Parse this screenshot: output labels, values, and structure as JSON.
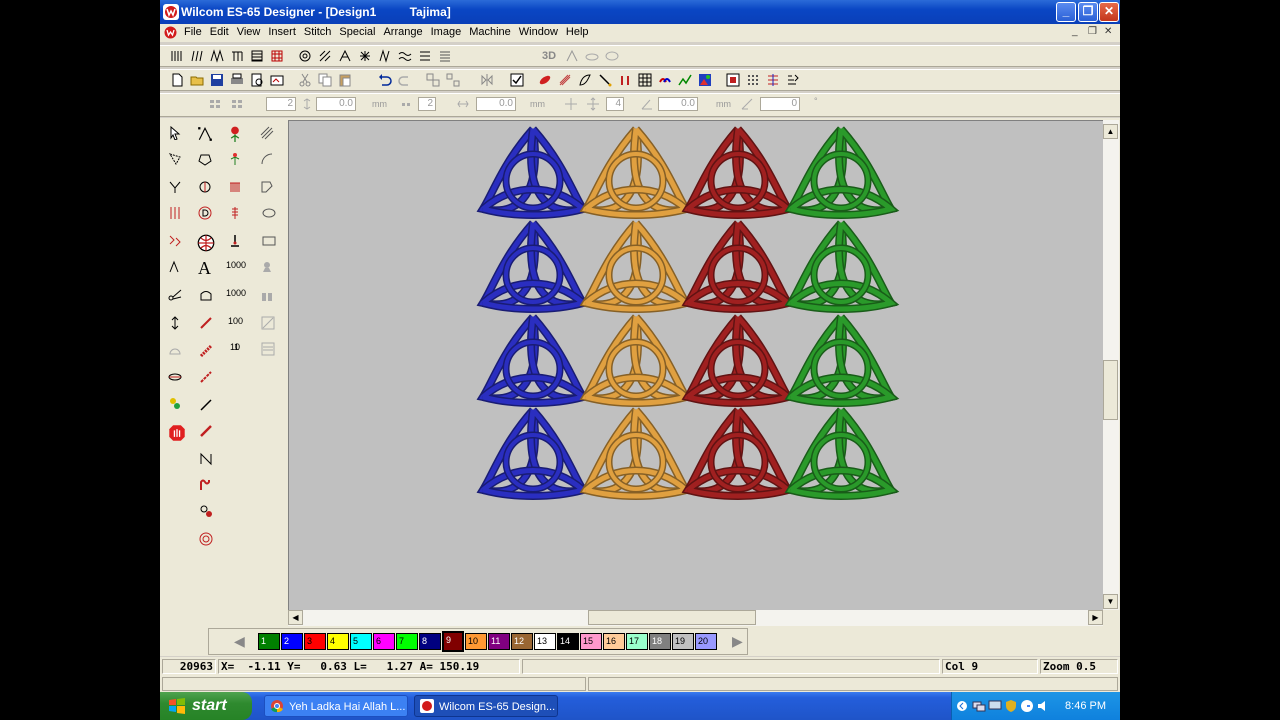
{
  "window": {
    "title": "Wilcom ES-65 Designer - [Design1          Tajima]",
    "minimize": "_",
    "restore": "❐",
    "close": "✕"
  },
  "menu": {
    "items": [
      "File",
      "Edit",
      "View",
      "Insert",
      "Stitch",
      "Special",
      "Arrange",
      "Image",
      "Machine",
      "Window",
      "Help"
    ]
  },
  "toolbar3": {
    "field1": "2",
    "field2": "0.0",
    "unit2": "mm",
    "field3": "2",
    "field4": "0.0",
    "unit4": "mm",
    "field5": "4",
    "field6": "0.0",
    "unit6": "mm",
    "field7": "0",
    "unit7": "°"
  },
  "toolbar1": {
    "label_3d": "3D"
  },
  "tools": {
    "text_tool": "A",
    "count_1000_a": "1000",
    "count_1000_b": "1000",
    "count_100": "100",
    "count_10": "10",
    "count_1": "1"
  },
  "canvas": {
    "background": "#c0c0c0",
    "rows": 4,
    "columns": [
      {
        "color": "#2a2ec0",
        "name": "blue"
      },
      {
        "color": "#e0a040",
        "name": "orange"
      },
      {
        "color": "#a02020",
        "name": "red"
      },
      {
        "color": "#2a9a2a",
        "name": "green"
      }
    ]
  },
  "palette": {
    "swatches": [
      {
        "label": "1",
        "color": "#008000"
      },
      {
        "label": "2",
        "color": "#0000ff"
      },
      {
        "label": "3",
        "color": "#ff0000"
      },
      {
        "label": "4",
        "color": "#ffff00"
      },
      {
        "label": "5",
        "color": "#00ffff"
      },
      {
        "label": "6",
        "color": "#ff00ff"
      },
      {
        "label": "7",
        "color": "#00ff00"
      },
      {
        "label": "8",
        "color": "#000080"
      },
      {
        "label": "9",
        "color": "#800000",
        "selected": true
      },
      {
        "label": "10",
        "color": "#ff9933"
      },
      {
        "label": "11",
        "color": "#800080"
      },
      {
        "label": "12",
        "color": "#996633"
      },
      {
        "label": "13",
        "color": "#ffffff"
      },
      {
        "label": "14",
        "color": "#000000"
      },
      {
        "label": "15",
        "color": "#ff99cc"
      },
      {
        "label": "16",
        "color": "#ffcc99"
      },
      {
        "label": "17",
        "color": "#99ffcc"
      },
      {
        "label": "18",
        "color": "#808080"
      },
      {
        "label": "19",
        "color": "#c0c0c0"
      },
      {
        "label": "20",
        "color": "#9999ff"
      }
    ]
  },
  "status": {
    "stitches": "20963",
    "coords": "X=  -1.11 Y=   0.63 L=   1.27 A= 150.19",
    "color": "Col 9",
    "zoom": "Zoom 0.5"
  },
  "taskbar": {
    "start": "start",
    "apps": [
      {
        "label": "Yeh Ladka Hai Allah L..."
      },
      {
        "label": "Wilcom ES-65 Design..."
      }
    ],
    "clock": "8:46 PM"
  }
}
